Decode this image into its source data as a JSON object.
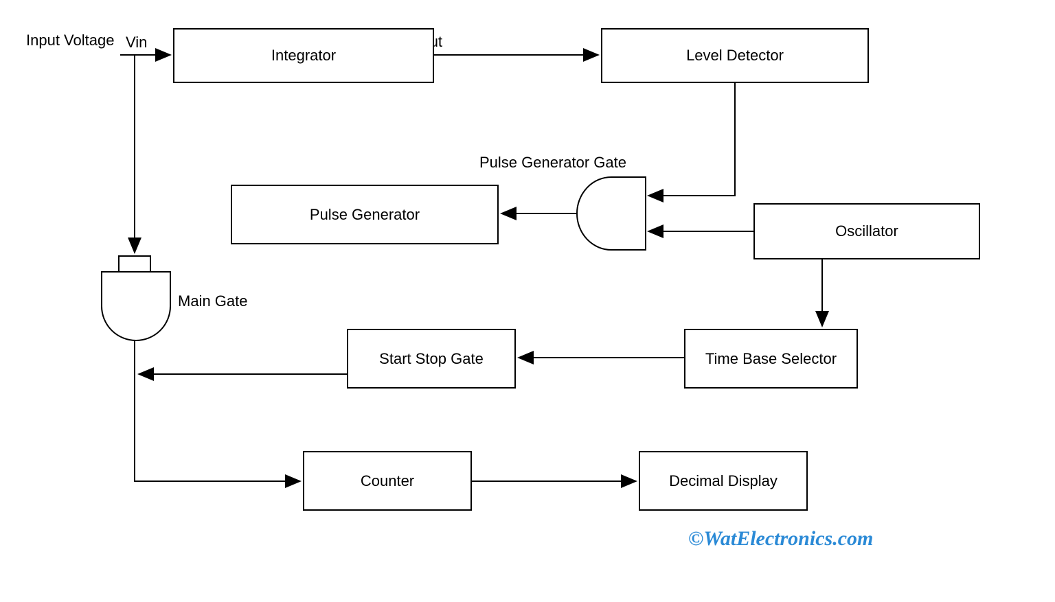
{
  "labels": {
    "input_voltage": "Input Voltage",
    "vin": "Vin",
    "vout": "Vout",
    "pulse_generator_gate": "Pulse Generator Gate",
    "main_gate": "Main Gate"
  },
  "blocks": {
    "integrator": "Integrator",
    "level_detector": "Level Detector",
    "pulse_generator": "Pulse Generator",
    "oscillator": "Oscillator",
    "start_stop_gate": "Start Stop Gate",
    "time_base_selector": "Time Base Selector",
    "counter": "Counter",
    "decimal_display": "Decimal Display"
  },
  "watermark": "©WatElectronics.com"
}
